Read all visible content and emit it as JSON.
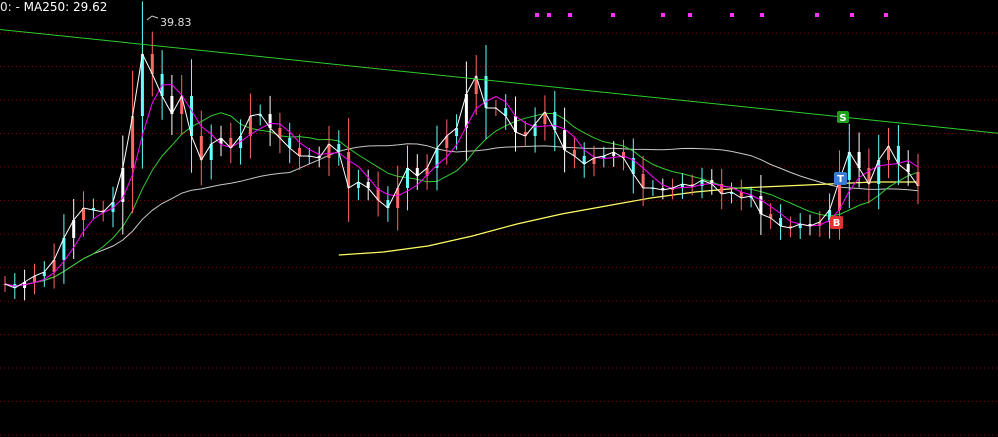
{
  "header": {
    "indicator_prefix": "0: -",
    "ma250_label": "MA250:",
    "ma250_value": "29.62"
  },
  "annotations": {
    "peak_label": "39.83",
    "signal_s": "S",
    "signal_t": "T",
    "signal_b": "B"
  },
  "colors": {
    "background": "#000000",
    "gridline": "#8a0000",
    "trendline": "#2ecc2e",
    "price": "#ffffff",
    "ma_short": "#ff00ff",
    "ma_mid": "#33cc33",
    "ma_long": "#c8c8c8",
    "ma250": "#ffff66",
    "signal_s": "#1aa31a",
    "signal_t": "#3a7bd5",
    "signal_b": "#d33",
    "markers": "#ff33ff"
  },
  "chart_data": {
    "type": "line",
    "title": "",
    "legend": "MA250: 29.62",
    "ylim": [
      24,
      40.2
    ],
    "grid": true,
    "peak": {
      "index": 14,
      "value": 39.83
    },
    "price_series": [
      26.8,
      26.6,
      26.9,
      27.2,
      27.4,
      28.0,
      29.1,
      30.0,
      30.6,
      30.5,
      30.4,
      30.9,
      32.6,
      35.2,
      38.3,
      37.3,
      36.2,
      35.3,
      36.2,
      34.2,
      33.0,
      33.8,
      34.1,
      33.6,
      34.2,
      35.2,
      35.3,
      34.6,
      34.1,
      33.6,
      33.2,
      33.2,
      33.1,
      33.8,
      33.4,
      31.6,
      31.9,
      31.6,
      31.0,
      30.6,
      31.6,
      32.6,
      32.2,
      32.6,
      33.6,
      34.2,
      34.6,
      36.3,
      37.2,
      35.6,
      35.6,
      35.2,
      34.4,
      34.2,
      34.8,
      35.4,
      34.5,
      33.5,
      33.2,
      32.8,
      33.1,
      33.2,
      33.4,
      33.1,
      32.3,
      31.6,
      31.6,
      31.5,
      31.6,
      31.8,
      31.7,
      32.0,
      31.8,
      31.3,
      31.4,
      31.1,
      31.2,
      30.3,
      30.1,
      29.7,
      29.6,
      29.8,
      29.7,
      29.9,
      30.5,
      32.0,
      33.4,
      32.6,
      31.8,
      33.0,
      33.7,
      32.8,
      32.4,
      31.7
    ],
    "ma250": {
      "name": "MA250",
      "start_index": 34,
      "values": [
        28.25,
        28.4,
        28.7,
        29.2,
        29.8,
        30.3,
        30.7,
        31.1,
        31.4,
        31.6,
        31.7,
        31.8,
        31.9,
        31.9
      ]
    },
    "signals": [
      {
        "label": "S",
        "index": 84,
        "value": 35.8
      },
      {
        "label": "T",
        "index": 84,
        "value": 32.7
      },
      {
        "label": "B",
        "index": 84,
        "value": 30.95
      }
    ],
    "trendline": {
      "from": {
        "index": 0,
        "value": 39.5
      },
      "to": {
        "index": 98,
        "value": 34.5
      }
    }
  }
}
